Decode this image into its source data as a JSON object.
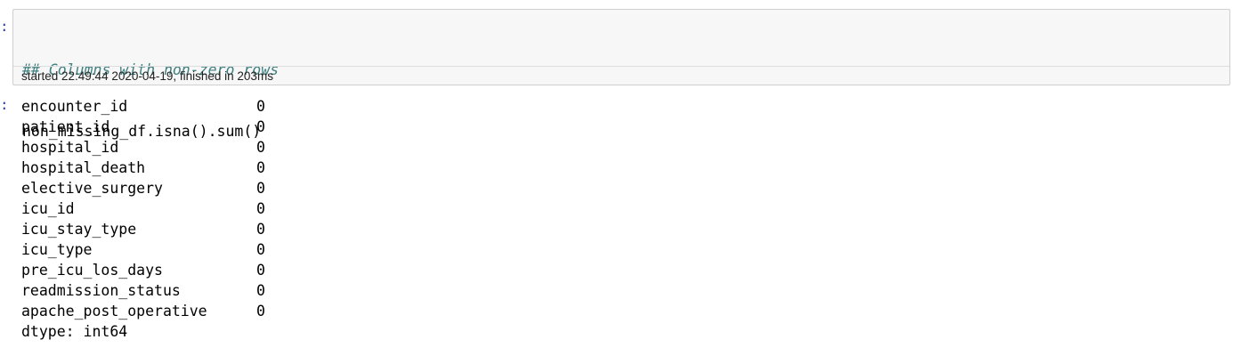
{
  "input_cell": {
    "prompt": ":",
    "comment_line": "## Columns with non-zero rows",
    "code_line": "non_missing_df.isna().sum()",
    "exec_status": "started 22:49:44 2020-04-19, finished in 203ms"
  },
  "output_cell": {
    "prompt": ":",
    "rows": [
      {
        "name": "encounter_id",
        "value": "0"
      },
      {
        "name": "patient_id",
        "value": "0"
      },
      {
        "name": "hospital_id",
        "value": "0"
      },
      {
        "name": "hospital_death",
        "value": "0"
      },
      {
        "name": "elective_surgery",
        "value": "0"
      },
      {
        "name": "icu_id",
        "value": "0"
      },
      {
        "name": "icu_stay_type",
        "value": "0"
      },
      {
        "name": "icu_type",
        "value": "0"
      },
      {
        "name": "pre_icu_los_days",
        "value": "0"
      },
      {
        "name": "readmission_status",
        "value": "0"
      },
      {
        "name": "apache_post_operative",
        "value": "0"
      }
    ],
    "dtype_line": "dtype: int64"
  }
}
